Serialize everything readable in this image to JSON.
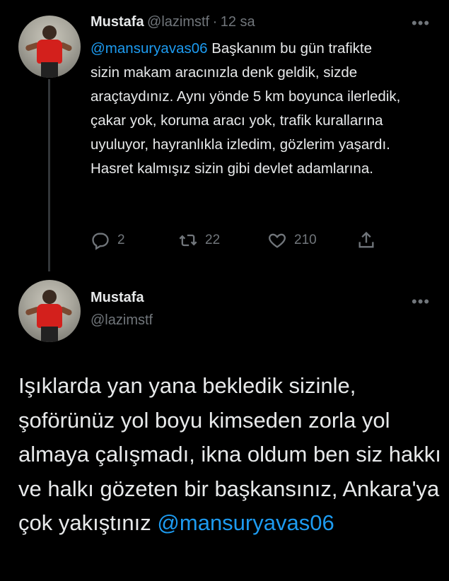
{
  "tweet1": {
    "name": "Mustafa",
    "handle": "@lazimstf",
    "separator": "·",
    "time": "12 sa",
    "mention": "@mansuryavas06",
    "text": " Başkanım bu gün trafikte sizin makam aracınızla denk geldik, sizde araçtaydınız. Aynı yönde 5 km boyunca ilerledik, çakar yok, koruma aracı yok, trafik kurallarına uyuluyor, hayranlıkla izledim, gözlerim yaşardı. Hasret kalmışız sizin gibi devlet adamlarına.",
    "more_label": "•••",
    "actions": {
      "reply_count": "2",
      "retweet_count": "22",
      "like_count": "210"
    }
  },
  "tweet2": {
    "name": "Mustafa",
    "handle": "@lazimstf",
    "more_label": "•••",
    "text": "Işıklarda yan yana bekledik sizinle, şoförünüz yol boyu kimseden zorla yol almaya çalışmadı, ikna oldum ben siz hakkı ve halkı gözeten bir başkansınız, Ankara'ya çok yakıştınız ",
    "mention": "@mansuryavas06"
  },
  "icons": {
    "reply": "reply-icon",
    "retweet": "retweet-icon",
    "like": "heart-icon",
    "share": "share-icon",
    "more": "more-icon"
  },
  "colors": {
    "background": "#000000",
    "text": "#e7e9ea",
    "muted": "#71767b",
    "mention": "#1d9bf0"
  }
}
